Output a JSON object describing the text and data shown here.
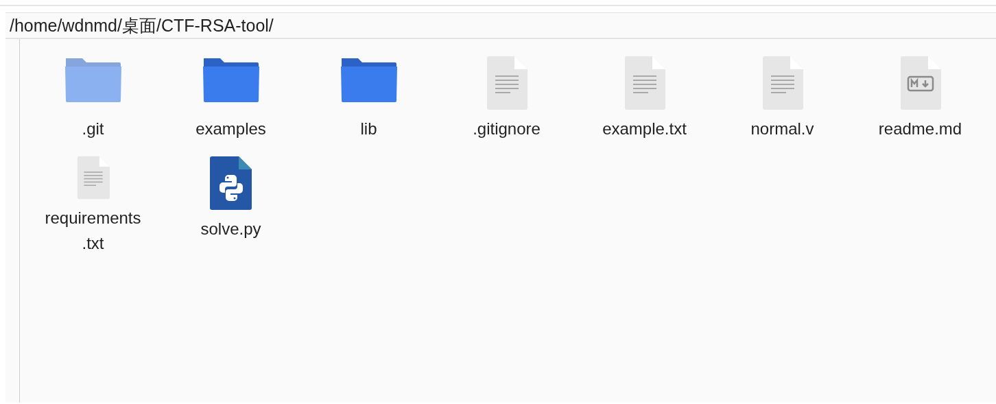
{
  "path_bar": {
    "path": "/home/wdnmd/桌面/CTF-RSA-tool/"
  },
  "files": [
    {
      "name": ".git",
      "kind": "folder",
      "dimmed": true
    },
    {
      "name": "examples",
      "kind": "folder",
      "dimmed": false
    },
    {
      "name": "lib",
      "kind": "folder",
      "dimmed": false
    },
    {
      "name": ".gitignore",
      "kind": "text",
      "dimmed": false
    },
    {
      "name": "example.txt",
      "kind": "text",
      "dimmed": false
    },
    {
      "name": "normal.v",
      "kind": "text",
      "dimmed": false
    },
    {
      "name": "readme.md",
      "kind": "markdown",
      "dimmed": false
    },
    {
      "name": "requirements.txt",
      "kind": "text",
      "dimmed": false
    },
    {
      "name": "solve.py",
      "kind": "python",
      "dimmed": false
    }
  ]
}
